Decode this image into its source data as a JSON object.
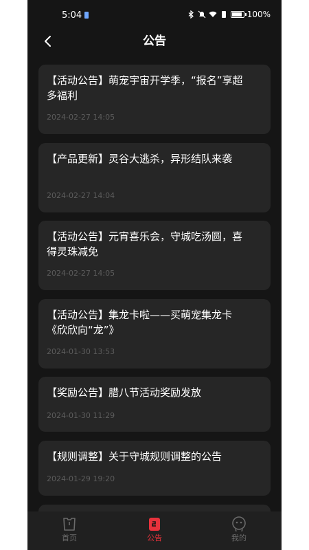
{
  "status_bar": {
    "time": "5:04",
    "battery": "100%"
  },
  "header": {
    "title": "公告"
  },
  "announcements": [
    {
      "title": "【活动公告】萌宠宇宙开学季，“报名”享超多福利",
      "date": "2024-02-27 14:05"
    },
    {
      "title": "【产品更新】灵谷大逃杀，异形结队来袭",
      "date": "2024-02-27 14:04"
    },
    {
      "title": "【活动公告】元宵喜乐会，守城吃汤圆，喜得灵珠减免",
      "date": "2024-02-27 14:05"
    },
    {
      "title": "【活动公告】集龙卡啦——买萌宠集龙卡《欣欣向“龙”》",
      "date": "2024-01-30 13:53"
    },
    {
      "title": "【奖励公告】腊八节活动奖励发放",
      "date": "2024-01-30 11:29"
    },
    {
      "title": "【规则调整】关于守城规则调整的公告",
      "date": "2024-01-29 19:20"
    }
  ],
  "tab_bar": {
    "tabs": [
      {
        "label": "首页",
        "icon": "home-icon",
        "active": false
      },
      {
        "label": "公告",
        "icon": "notice-icon",
        "active": true
      },
      {
        "label": "我的",
        "icon": "profile-icon",
        "active": false
      }
    ]
  },
  "colors": {
    "background": "#151515",
    "card": "#262626",
    "accent": "#e8323c",
    "inactive": "#6a6a6a"
  }
}
